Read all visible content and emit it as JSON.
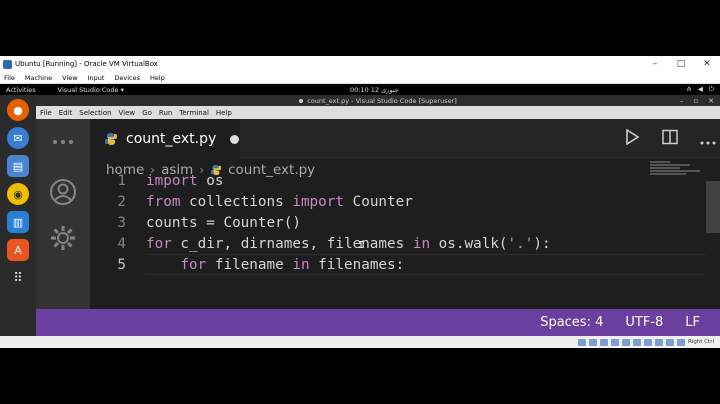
{
  "host": {
    "window_title": "Ubuntu [Running] - Oracle VM VirtualBox",
    "window_controls": [
      "–",
      "□",
      "✕"
    ],
    "menu": [
      "File",
      "Machine",
      "View",
      "Input",
      "Devices",
      "Help"
    ],
    "host_key": "Right Ctrl"
  },
  "guest": {
    "activities": "Activities",
    "app_menu": "Visual Studio Code ▾",
    "clock": "00:10  12 جنوری",
    "dock_icons": [
      "firefox-icon",
      "thunderbird-icon",
      "files-icon",
      "rhythmbox-icon",
      "libreoffice-writer-icon",
      "software-center-icon",
      "show-apps-icon"
    ]
  },
  "vscode": {
    "window_title": "count_ext.py - Visual Studio Code [Superuser]",
    "window_controls": [
      "–",
      "▫",
      "✕"
    ],
    "menu": [
      "File",
      "Edit",
      "Selection",
      "View",
      "Go",
      "Run",
      "Terminal",
      "Help"
    ],
    "tab": {
      "filename": "count_ext.py",
      "modified": true
    },
    "breadcrumb": [
      "home",
      "asim",
      "count_ext.py"
    ],
    "code_lines": [
      {
        "num": "1",
        "tokens": [
          {
            "t": "import",
            "c": "kw"
          },
          {
            "t": " os",
            "c": "id"
          }
        ]
      },
      {
        "num": "2",
        "tokens": [
          {
            "t": "from",
            "c": "kw"
          },
          {
            "t": " collections ",
            "c": "id"
          },
          {
            "t": "import",
            "c": "kw"
          },
          {
            "t": " Counter",
            "c": "id"
          }
        ]
      },
      {
        "num": "3",
        "tokens": [
          {
            "t": "counts = Counter()",
            "c": "id"
          }
        ]
      },
      {
        "num": "4",
        "tokens": [
          {
            "t": "for",
            "c": "kw"
          },
          {
            "t": " c_dir, dirnames, filenames ",
            "c": "id"
          },
          {
            "t": "in",
            "c": "kw"
          },
          {
            "t": " os.walk(",
            "c": "id"
          },
          {
            "t": "'.'",
            "c": "str"
          },
          {
            "t": "):",
            "c": "id"
          }
        ]
      },
      {
        "num": "5",
        "tokens": [
          {
            "t": "    ",
            "c": "id"
          },
          {
            "t": "for",
            "c": "kw"
          },
          {
            "t": " filename ",
            "c": "id"
          },
          {
            "t": "in",
            "c": "kw"
          },
          {
            "t": " filenames:",
            "c": "id"
          }
        ]
      }
    ],
    "current_line": "5",
    "status": {
      "spaces": "Spaces: 4",
      "encoding": "UTF-8",
      "eol": "LF"
    },
    "colors": {
      "statusbar": "#6a3fa0",
      "keyword": "#c586c0",
      "string": "#ce9178"
    }
  }
}
